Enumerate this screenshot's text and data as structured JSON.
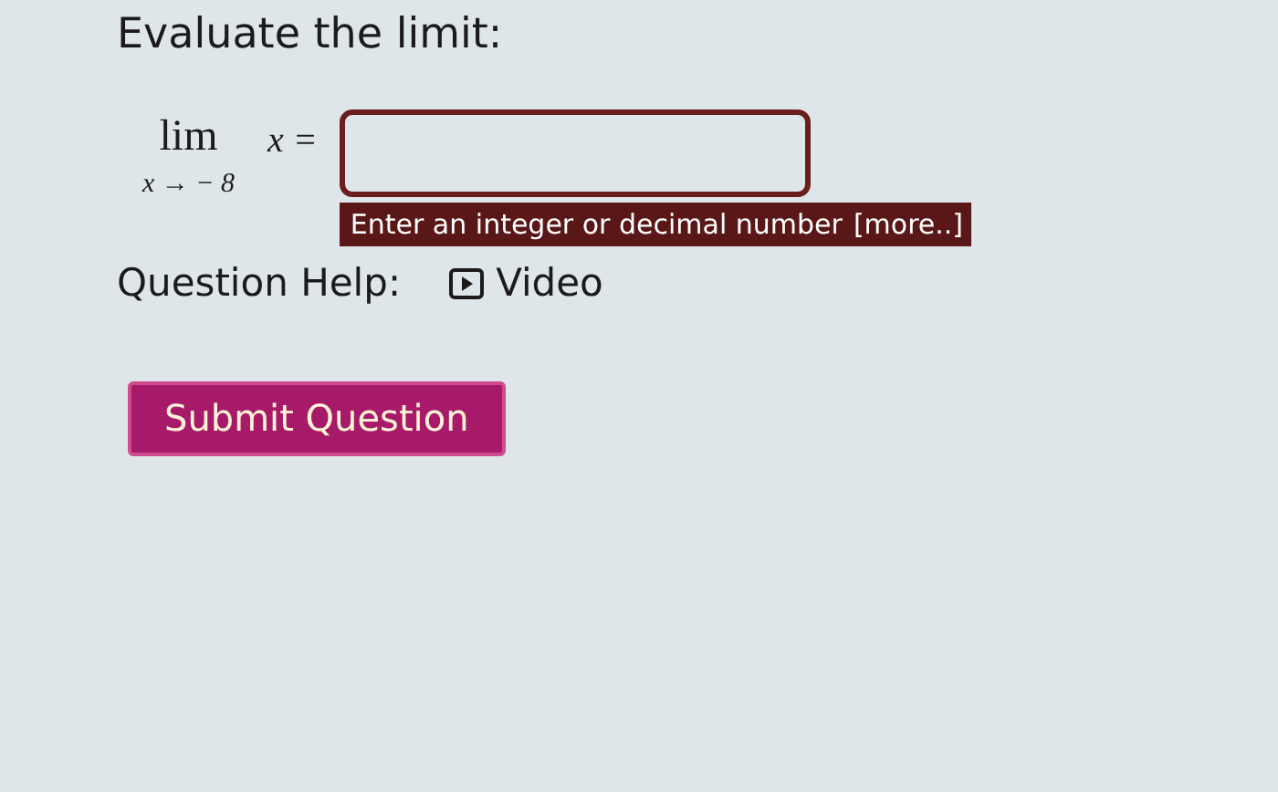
{
  "prompt": "Evaluate the limit:",
  "limit": {
    "operator": "lim",
    "subscript": "x → − 8",
    "expression": "x ="
  },
  "answer_field": {
    "hint": "Enter an integer or decimal number",
    "more_link": "[more..]"
  },
  "question_help": {
    "label": "Question Help:",
    "video_link": "Video"
  },
  "submit_button": "Submit Question"
}
